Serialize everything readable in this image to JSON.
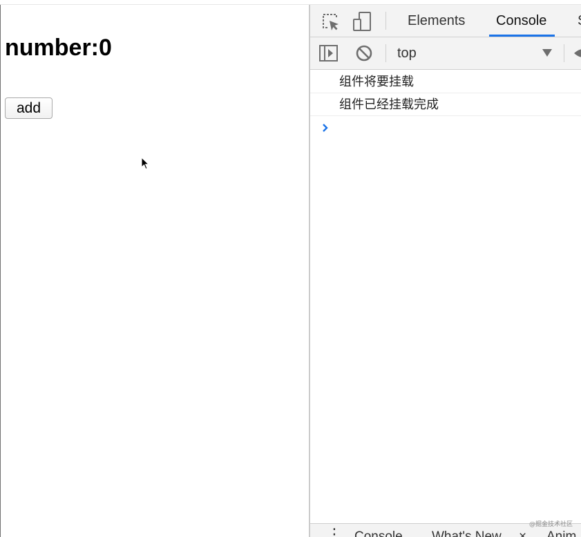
{
  "page": {
    "heading": "number:0",
    "add_button": "add"
  },
  "devtools": {
    "tabs": [
      {
        "label": "Elements",
        "active": false
      },
      {
        "label": "Console",
        "active": true
      },
      {
        "label": "S",
        "active": false
      }
    ],
    "context": "top",
    "logs": [
      "组件将要挂载",
      "组件已经挂载完成"
    ],
    "drawer_tabs": [
      "Console",
      "What's New",
      "×",
      "Anim"
    ]
  },
  "watermark": "@掘金技术社区",
  "colors": {
    "accent": "#1a73e8",
    "toolbar_bg": "#f3f3f3"
  },
  "icons": [
    "inspect-element-icon",
    "device-toolbar-icon",
    "sidebar-toggle-icon",
    "clear-console-icon",
    "prompt-chevron-icon",
    "mouse-cursor-icon"
  ]
}
